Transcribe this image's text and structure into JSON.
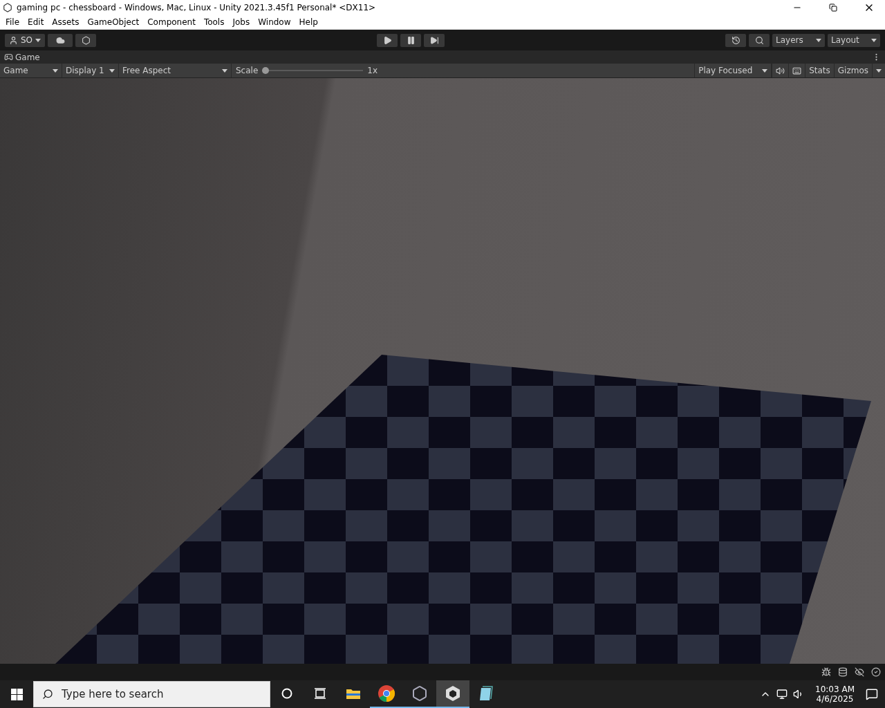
{
  "window": {
    "title": "gaming pc - chessboard - Windows, Mac, Linux - Unity 2021.3.45f1 Personal* <DX11>"
  },
  "menu": [
    "File",
    "Edit",
    "Assets",
    "GameObject",
    "Component",
    "Tools",
    "Jobs",
    "Window",
    "Help"
  ],
  "toolbar": {
    "account": "SO",
    "play_controls": [
      {
        "kind": "play",
        "selected": false
      },
      {
        "kind": "pause",
        "selected": false
      },
      {
        "kind": "step",
        "selected": false
      }
    ],
    "layers": "Layers",
    "layout": "Layout"
  },
  "game_tab": {
    "title": "Game"
  },
  "game_toolbar": {
    "view": "Game",
    "display": "Display 1",
    "aspect": "Free Aspect",
    "scale_label": "Scale",
    "scale": {
      "level": 0
    },
    "scale_reading": "1x",
    "play_mode": "Play Focused",
    "stats": "Stats",
    "gizmos": "Gizmos"
  },
  "taskbar": {
    "search_placeholder": "Type here to search",
    "apps": [
      {
        "kind": "explorer",
        "running": false,
        "selected": false
      },
      {
        "kind": "chrome",
        "running": true,
        "selected": false
      },
      {
        "kind": "hub",
        "running": true,
        "selected": false
      },
      {
        "kind": "unity",
        "running": true,
        "selected": true
      },
      {
        "kind": "notepad",
        "running": false,
        "selected": false
      }
    ],
    "time": "10:03 AM",
    "date": "4/6/2025"
  }
}
